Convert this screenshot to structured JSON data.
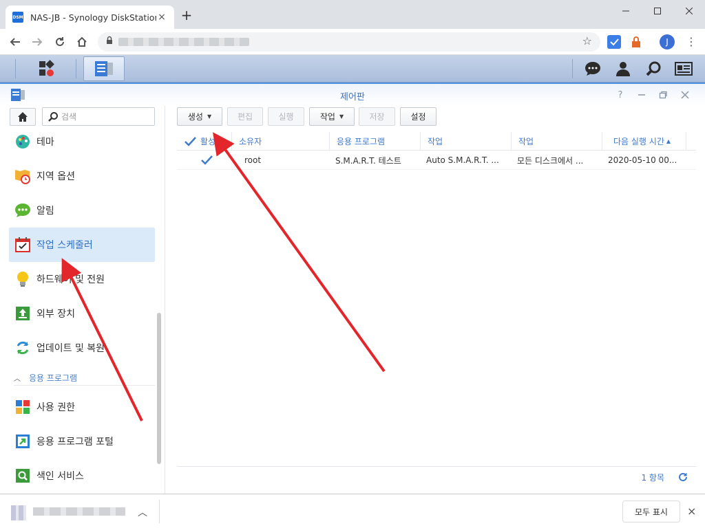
{
  "browser": {
    "tab_title": "NAS-JB - Synology DiskStation",
    "favicon_text": "DSM",
    "tab_close": "×",
    "new_tab": "+",
    "profile_initial": "J"
  },
  "window": {
    "title": "제어판"
  },
  "sidebar": {
    "search_placeholder": "검색",
    "items": [
      {
        "label": "테마",
        "icon": "palette-icon"
      },
      {
        "label": "지역 옵션",
        "icon": "map-clock-icon"
      },
      {
        "label": "알림",
        "icon": "chat-bubble-icon"
      },
      {
        "label": "작업 스케줄러",
        "icon": "calendar-check-icon",
        "selected": true
      },
      {
        "label": "하드웨어 및 전원",
        "icon": "lightbulb-icon"
      },
      {
        "label": "외부 장치",
        "icon": "upload-box-icon"
      },
      {
        "label": "업데이트 및 복원",
        "icon": "refresh-arrows-icon"
      }
    ],
    "section": "응용 프로그램",
    "section_items": [
      {
        "label": "사용 권한",
        "icon": "lock-grid-icon"
      },
      {
        "label": "응용 프로그램 포털",
        "icon": "portal-arrow-icon"
      },
      {
        "label": "색인 서비스",
        "icon": "search-index-icon"
      }
    ]
  },
  "toolbar": {
    "create": "생성",
    "edit": "편집",
    "run": "실행",
    "action": "작업",
    "save": "저장",
    "settings": "설정"
  },
  "grid": {
    "columns": [
      "활성",
      "소유자",
      "응용 프로그램",
      "작업",
      "작업",
      "다음 실행 시간"
    ],
    "sort_indicator": "▲",
    "rows": [
      {
        "enabled": true,
        "owner": "root",
        "app": "S.M.A.R.T. 테스트",
        "task": "Auto S.M.A.R.T. ...",
        "action": "모든 디스크에서 ...",
        "next_run": "2020-05-10 00..."
      }
    ],
    "count": "1 항목"
  },
  "shelf": {
    "show_all": "모두 표시",
    "close": "×"
  },
  "colors": {
    "accent": "#3d7acb",
    "selected_bg": "#dbeaf9",
    "arrow": "#e3262b"
  }
}
